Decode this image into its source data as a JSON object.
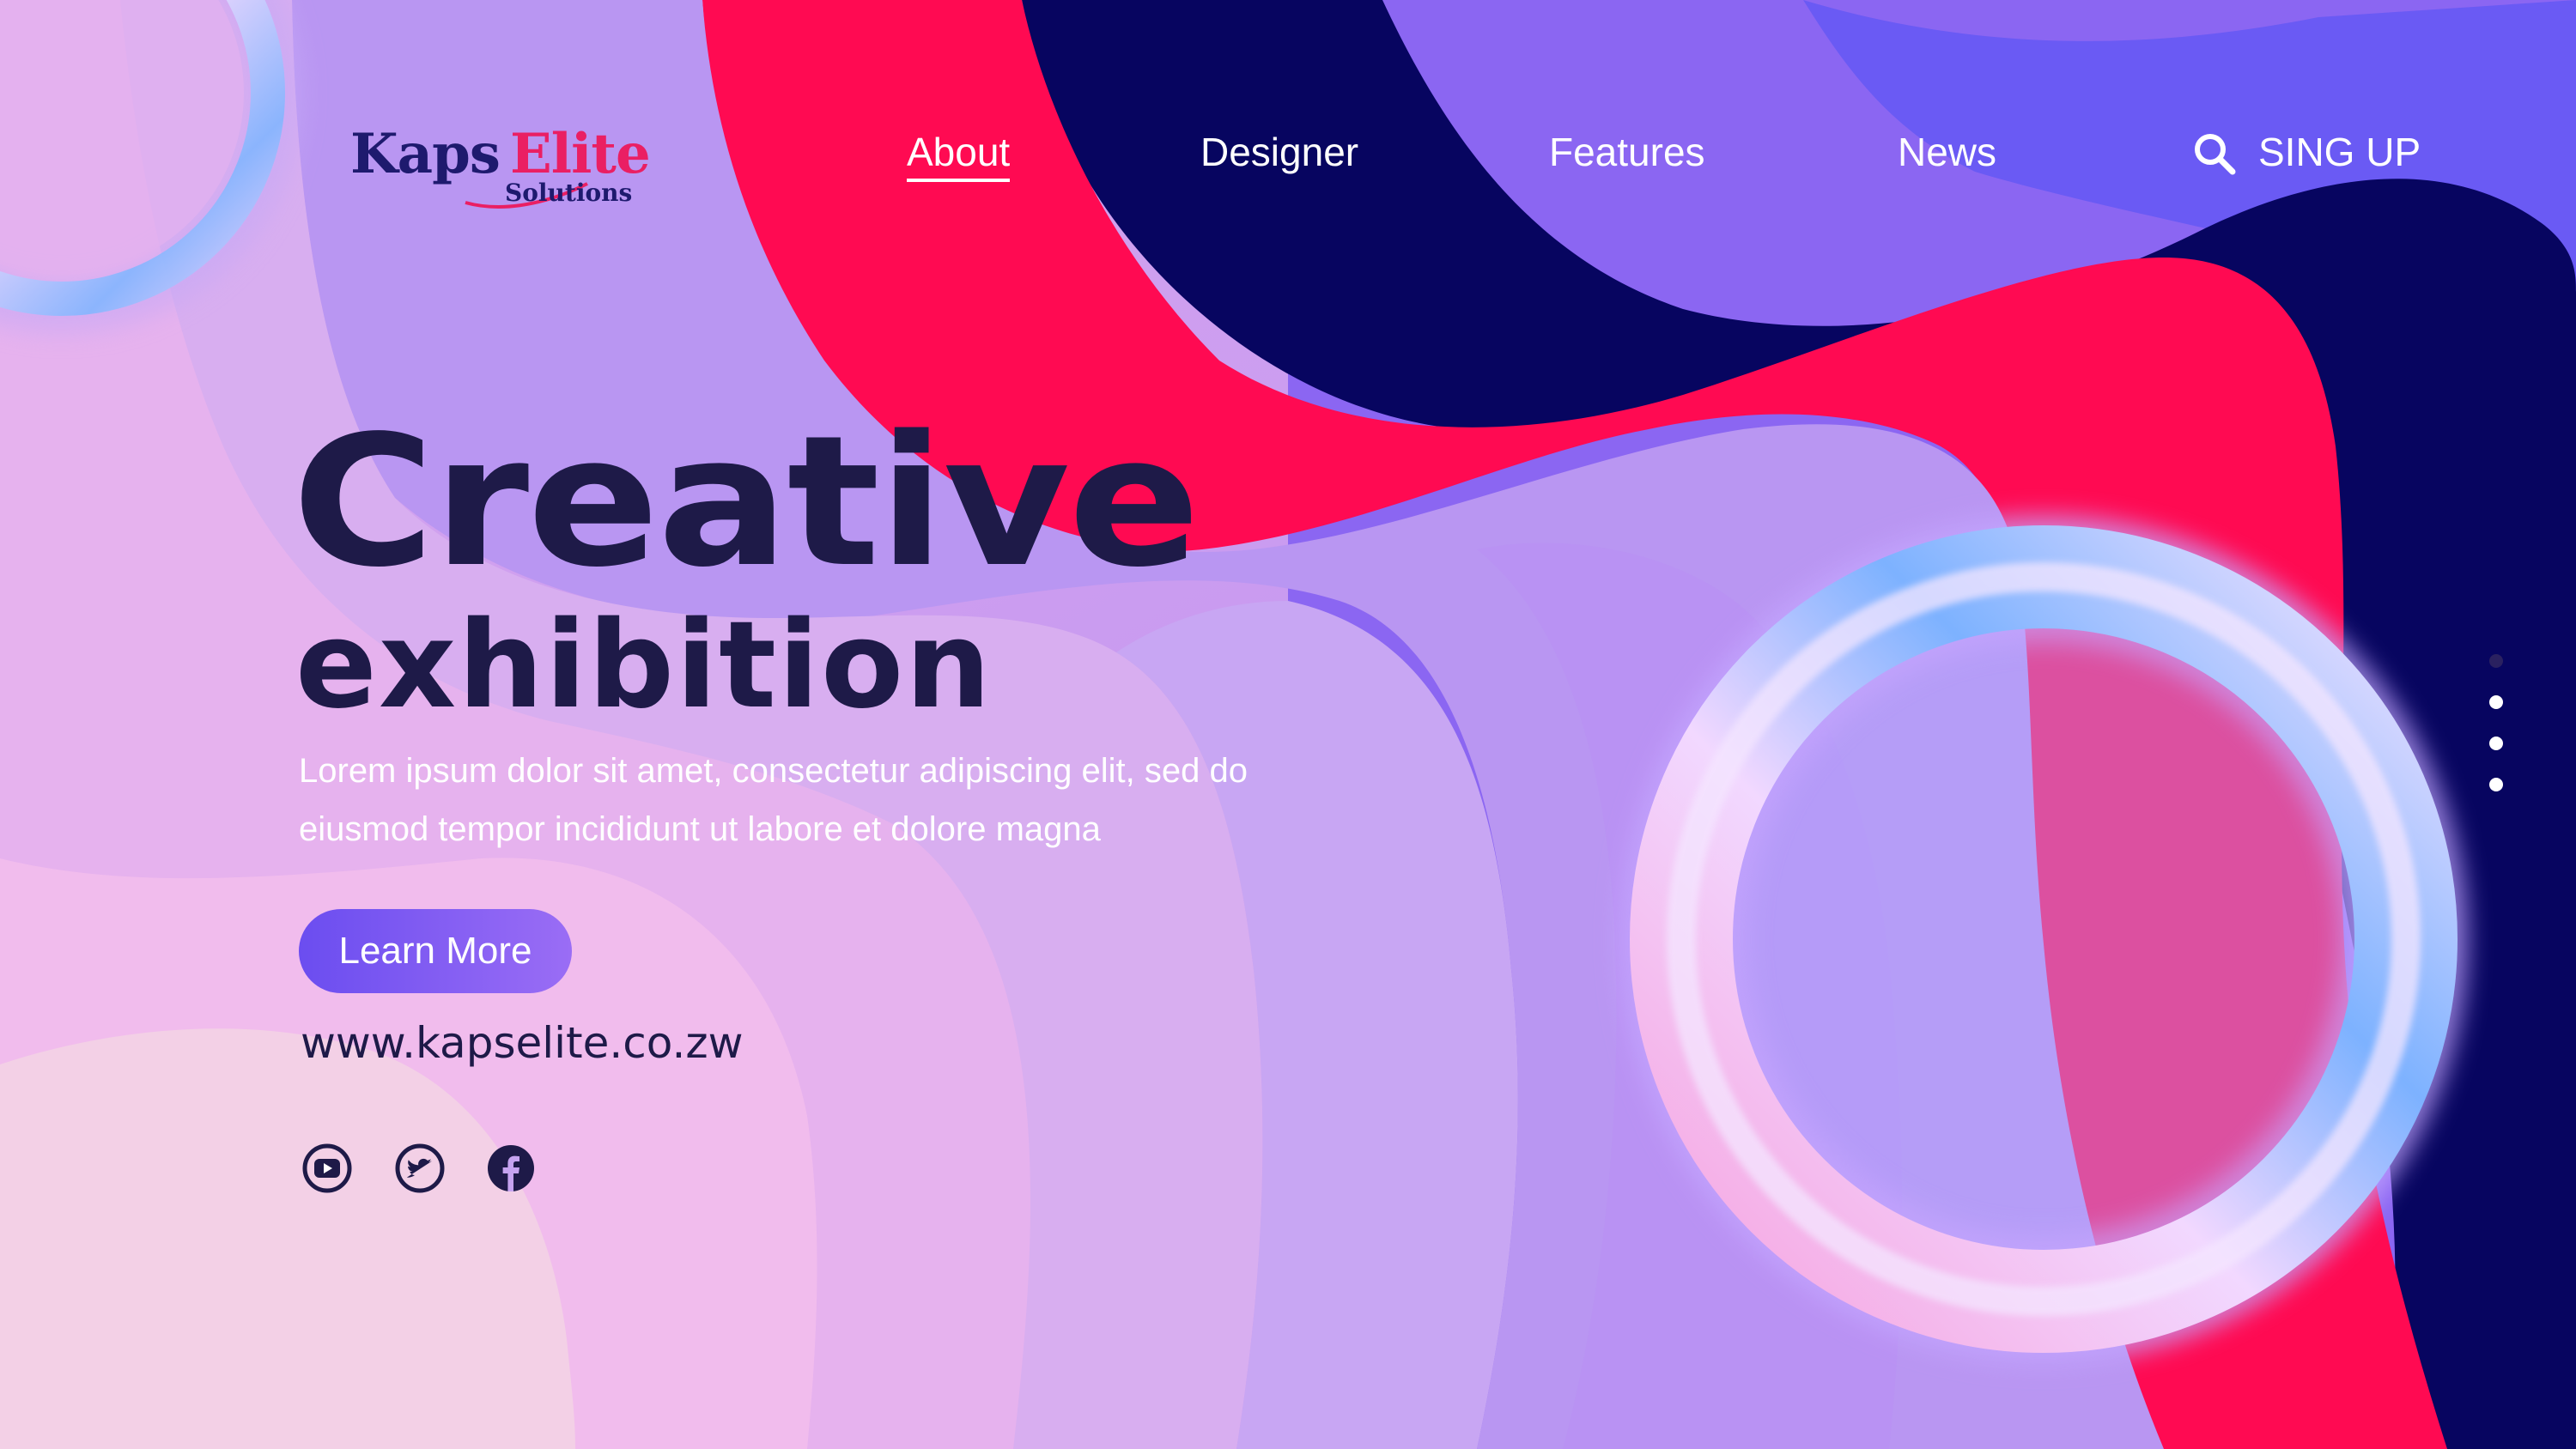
{
  "brand": {
    "name_part1": "Kaps",
    "name_part2": "Elite",
    "tagline": "Solutions",
    "primary_color": "#1e1a6e",
    "accent_color": "#ea1f63"
  },
  "nav": {
    "items": [
      {
        "label": "About",
        "active": true
      },
      {
        "label": "Designer",
        "active": false
      },
      {
        "label": "Features",
        "active": false
      },
      {
        "label": "News",
        "active": false
      }
    ],
    "search_icon": "search-icon",
    "signup_label": "SING UP"
  },
  "hero": {
    "title": "Creative",
    "subtitle": "exhibition",
    "body_line1": "Lorem ipsum dolor sit amet, consectetur adipiscing elit, sed do",
    "body_line2": "eiusmod tempor incididunt ut labore et dolore magna",
    "cta_label": "Learn More",
    "website": "www.kapselite.co.zw"
  },
  "social": [
    {
      "icon": "youtube-icon"
    },
    {
      "icon": "twitter-icon"
    },
    {
      "icon": "facebook-icon"
    }
  ],
  "slider": {
    "dot_count": 4,
    "active_index": 0
  },
  "colors": {
    "navy": "#070560",
    "red": "#ff0a52",
    "purple": "#8a62f0",
    "lavender": "#c7a4f2",
    "pink": "#f0b6ea",
    "cta": "#6b4df0",
    "text_dark": "#1e1a48"
  }
}
